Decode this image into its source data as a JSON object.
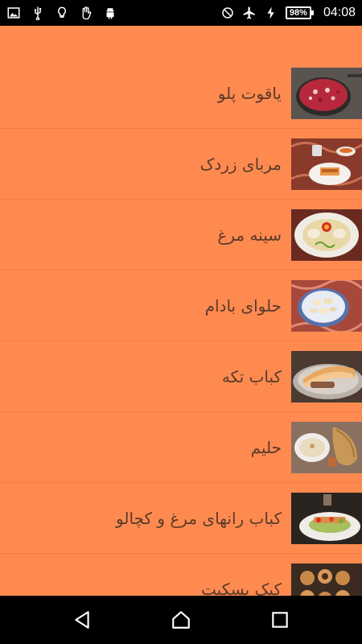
{
  "status_bar": {
    "left_icons": [
      "image-icon",
      "usb-icon",
      "lightbulb-icon",
      "hand-icon",
      "android-icon"
    ],
    "battery": "98%",
    "time": "04:08"
  },
  "recipes": [
    {
      "label": "یاقوت پلو",
      "thumb": "jeweled-rice-thumbnail"
    },
    {
      "label": "مربای زردک",
      "thumb": "carrot-jam-thumbnail"
    },
    {
      "label": "سینه مرغ",
      "thumb": "chicken-breast-thumbnail"
    },
    {
      "label": "حلوای بادام",
      "thumb": "almond-halva-thumbnail"
    },
    {
      "label": "کباب تکه",
      "thumb": "kabab-tekeh-thumbnail"
    },
    {
      "label": "حلیم",
      "thumb": "haleem-thumbnail"
    },
    {
      "label": "کباب رانهای مرغ و کچالو",
      "thumb": "chicken-thigh-kabab-thumbnail"
    },
    {
      "label": "کیک بسکیت",
      "thumb": "biscuit-cake-thumbnail"
    }
  ],
  "nav_bar": {
    "back": "back-icon",
    "home": "home-icon",
    "recents": "recents-icon"
  },
  "colors": {
    "background": "#FF8A50",
    "text": "#5A3A2A",
    "status_bar": "#000000"
  }
}
